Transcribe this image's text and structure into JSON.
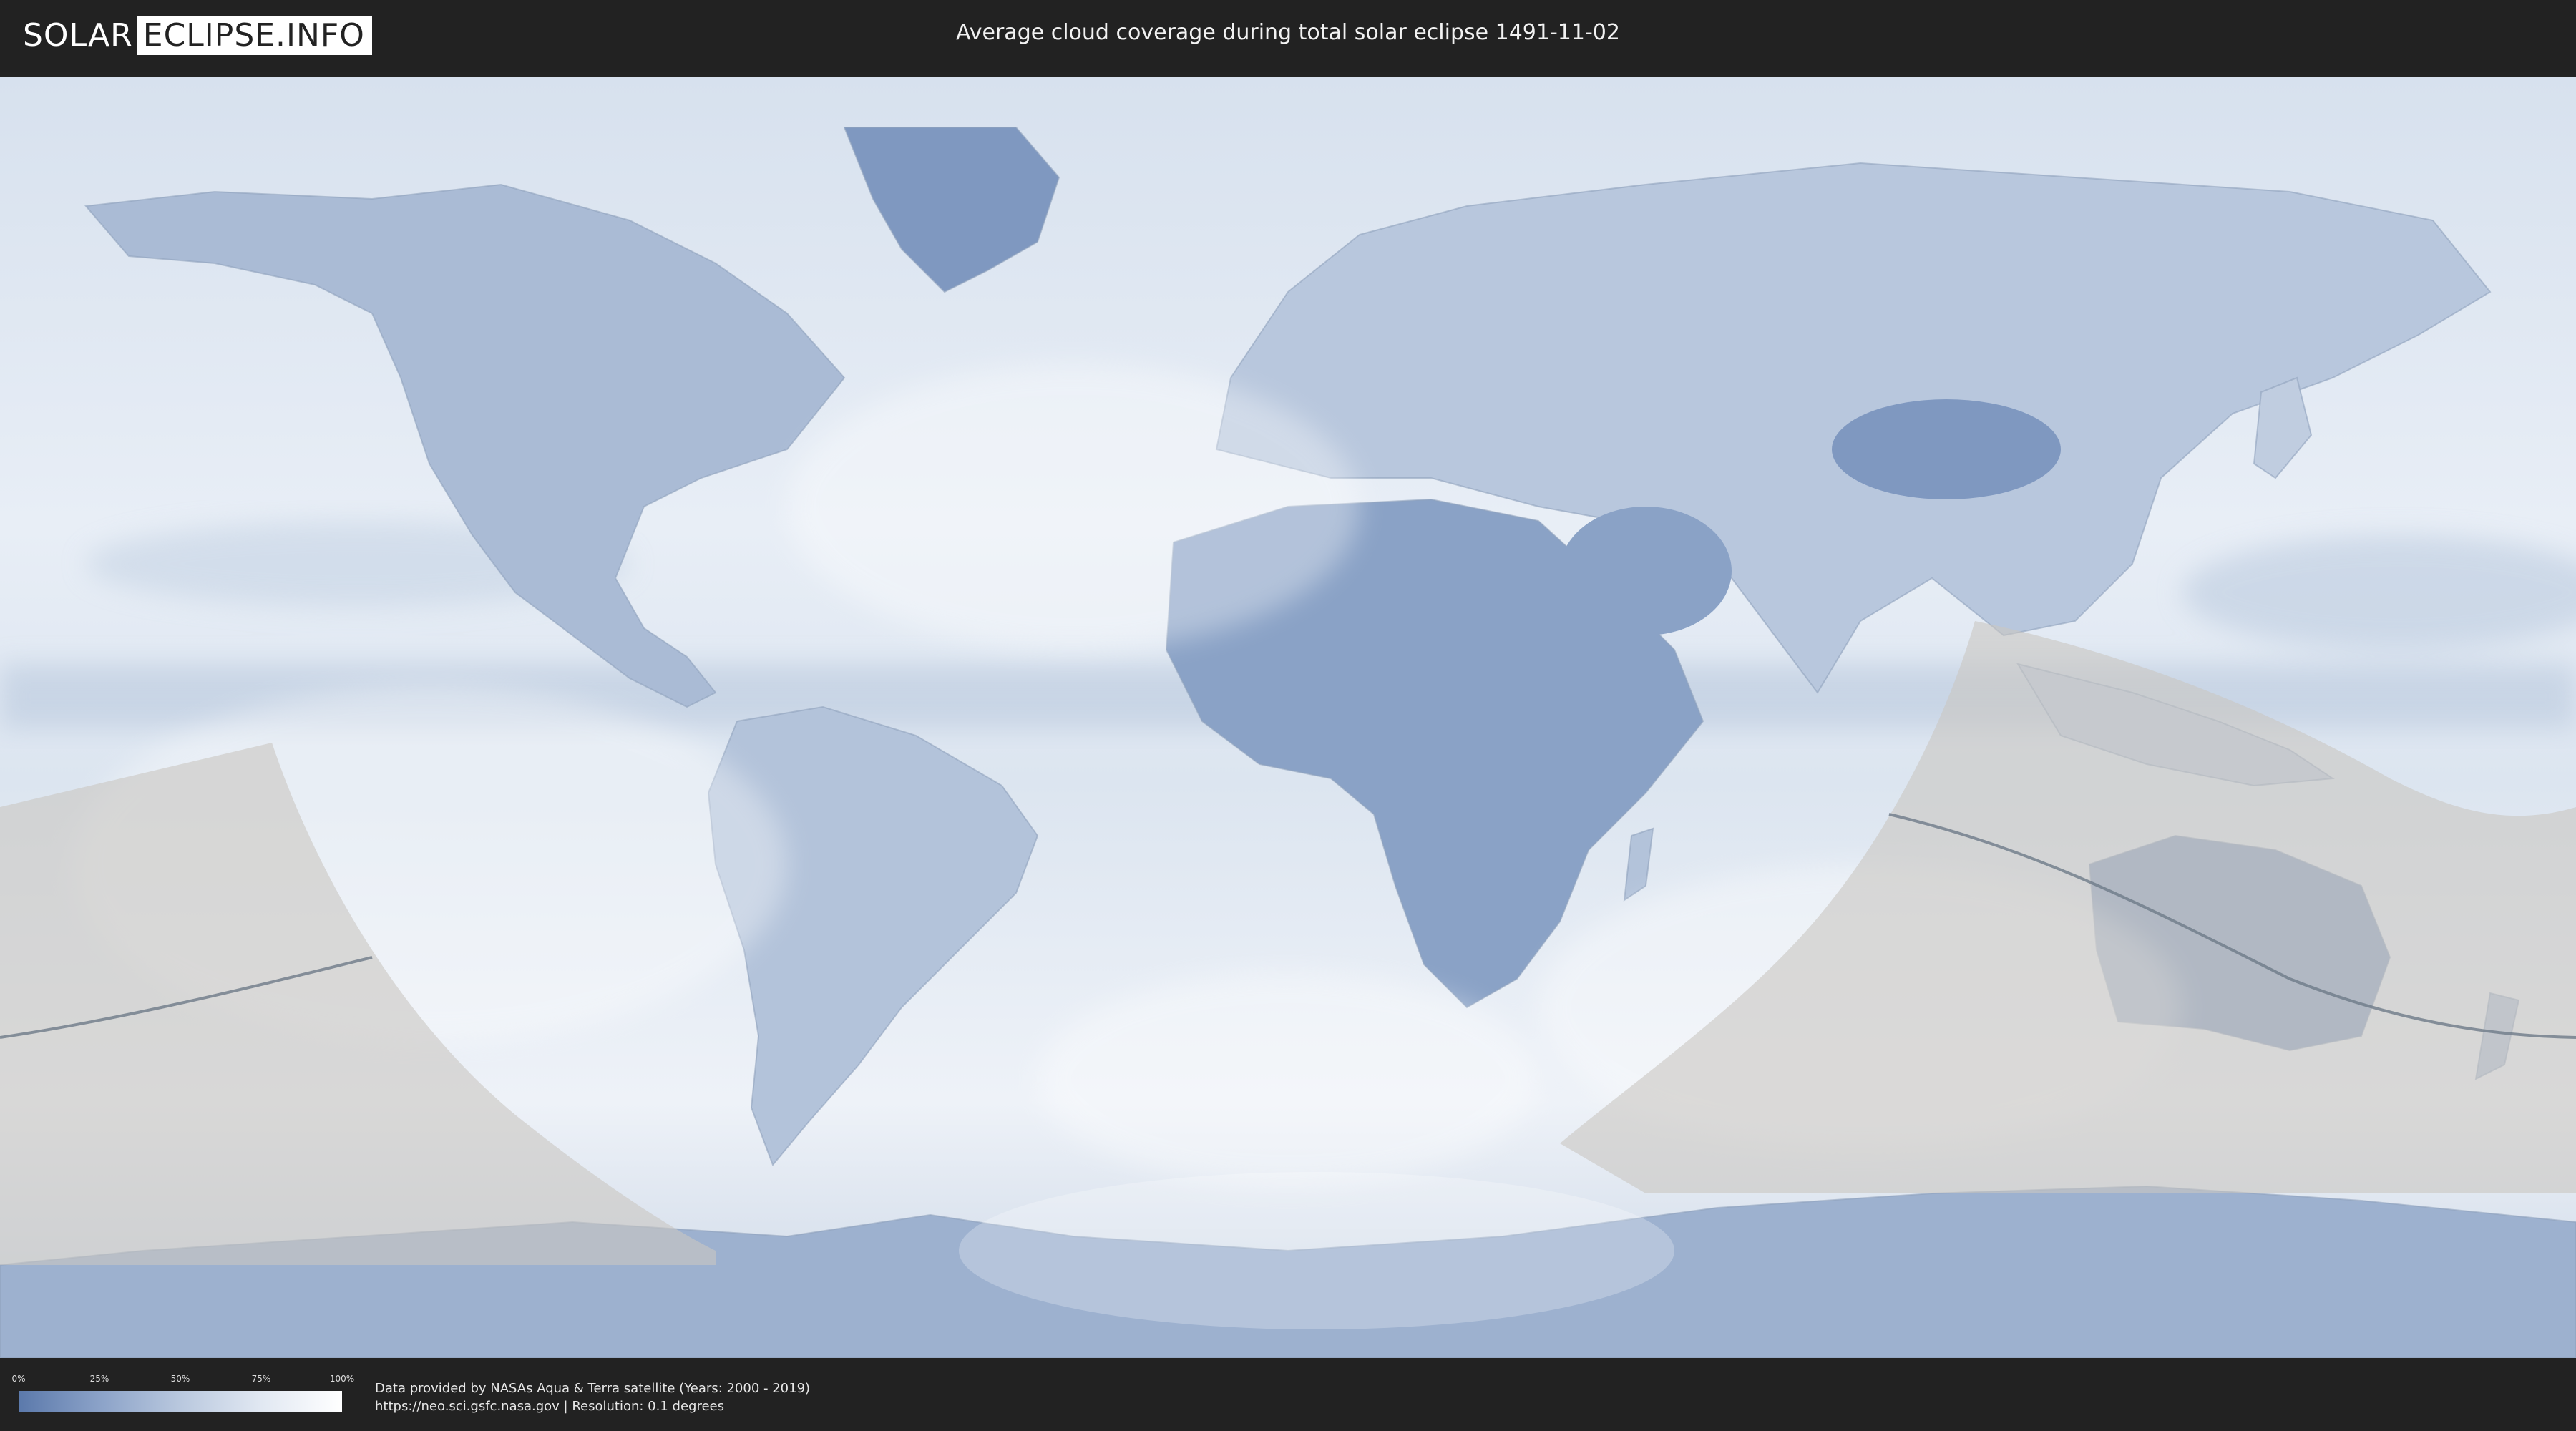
{
  "header": {
    "logo_solar": "SOLAR",
    "logo_eclipse": "ECLIPSE.INFO",
    "title": "Average cloud coverage during total solar eclipse 1491-11-02"
  },
  "legend": {
    "ticks": [
      "0%",
      "25%",
      "50%",
      "75%",
      "100%"
    ],
    "colors": [
      "#5b79ab",
      "#8ba2c8",
      "#b9c8de",
      "#e1e8f2",
      "#ffffff"
    ]
  },
  "footer": {
    "source_line1": "Data provided by NASAs Aqua & Terra satellite (Years: 2000 - 2019)",
    "source_line2": "https://neo.sci.gsfc.nasa.gov | Resolution: 0.1 degrees"
  },
  "map": {
    "projection": "equirectangular",
    "shading_color": "#c9c7c2",
    "eclipse_path_color": "#6e7a88"
  }
}
